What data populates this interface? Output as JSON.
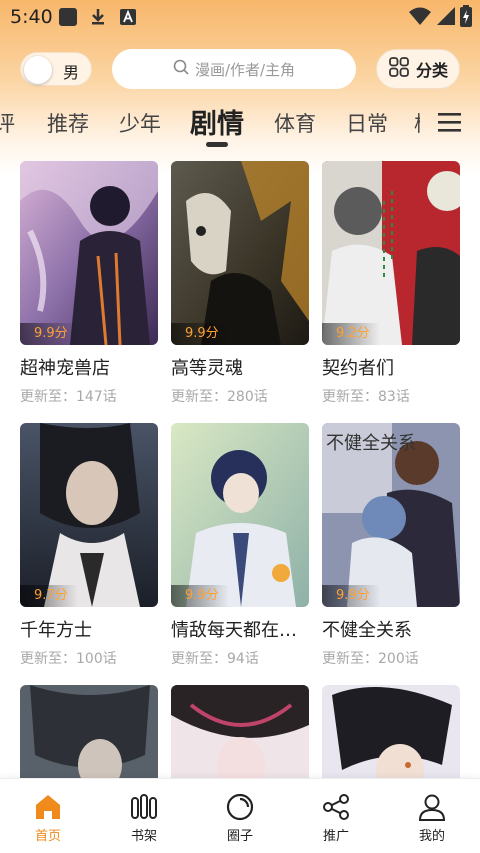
{
  "status_bar": {
    "time": "5:40"
  },
  "header": {
    "gender_toggle_label": "男",
    "search_placeholder": "漫画/作者/主角",
    "category_label": "分类"
  },
  "tabs": [
    {
      "label": "评"
    },
    {
      "label": "推荐"
    },
    {
      "label": "少年"
    },
    {
      "label": "剧情",
      "active": true
    },
    {
      "label": "体育"
    },
    {
      "label": "日常"
    },
    {
      "label": "校"
    }
  ],
  "comics": [
    {
      "title": "超神宠兽店",
      "score": "9.9分",
      "update": "更新至：147话"
    },
    {
      "title": "高等灵魂",
      "score": "9.9分",
      "update": "更新至：280话"
    },
    {
      "title": "契约者们",
      "score": "9.2分",
      "update": "更新至：83话"
    },
    {
      "title": "千年方士",
      "score": "9.7分",
      "update": "更新至：100话"
    },
    {
      "title": "情敌每天都在变美",
      "score": "9.9分",
      "update": "更新至：94话"
    },
    {
      "title": "不健全关系",
      "score": "9.9分",
      "update": "更新至：200话"
    },
    {
      "title": "",
      "score": "",
      "update": ""
    },
    {
      "title": "",
      "score": "",
      "update": ""
    },
    {
      "title": "",
      "score": "",
      "update": ""
    }
  ],
  "cover_text": {
    "comic_6": "不健全关系"
  },
  "bottom_nav": [
    {
      "label": "首页",
      "icon": "home-icon",
      "active": true
    },
    {
      "label": "书架",
      "icon": "bookshelf-icon"
    },
    {
      "label": "圈子",
      "icon": "circle-icon"
    },
    {
      "label": "推广",
      "icon": "share-icon"
    },
    {
      "label": "我的",
      "icon": "profile-icon"
    }
  ],
  "colors": {
    "accent": "#f08a1d",
    "score": "#ffa033",
    "header_gradient_top": "#f8b76b"
  }
}
